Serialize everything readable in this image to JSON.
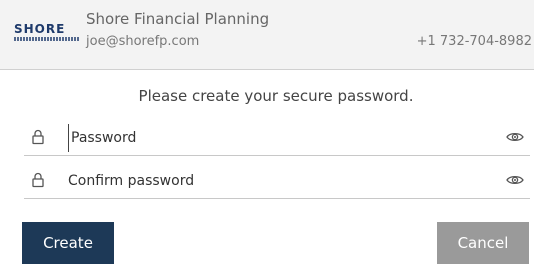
{
  "header": {
    "logo_text": "SHORE",
    "company_name": "Shore Financial Planning",
    "email": "joe@shorefp.com",
    "phone": "+1 732-704-8982"
  },
  "form": {
    "instruction": "Please create your secure password.",
    "password": {
      "placeholder": "Password",
      "value": "",
      "lock_icon": "lock-icon",
      "toggle_icon": "eye-icon"
    },
    "confirm_password": {
      "placeholder": "Confirm password",
      "value": "",
      "lock_icon": "lock-icon",
      "toggle_icon": "eye-icon"
    }
  },
  "actions": {
    "create_label": "Create",
    "cancel_label": "Cancel"
  },
  "colors": {
    "brand": "#1e3a6b",
    "primary_button": "#1d3957",
    "secondary_button": "#9a9a9a",
    "header_bg": "#f3f3f3"
  }
}
